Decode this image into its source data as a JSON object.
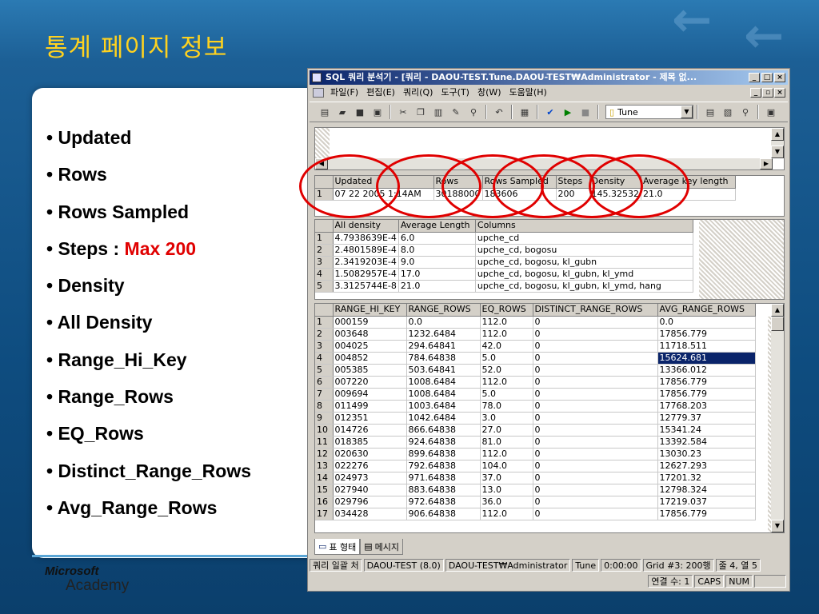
{
  "slide": {
    "title": "통계 페이지 정보",
    "bullets": [
      {
        "text": "Updated"
      },
      {
        "text": "Rows"
      },
      {
        "text": "Rows Sampled"
      },
      {
        "text": "Steps : ",
        "highlight": "Max 200"
      },
      {
        "text": "Density"
      },
      {
        "text": "All Density"
      },
      {
        "text": "Range_Hi_Key"
      },
      {
        "text": "Range_Rows"
      },
      {
        "text": "EQ_Rows"
      },
      {
        "text": "Distinct_Range_Rows"
      },
      {
        "text": "Avg_Range_Rows"
      }
    ],
    "logo_line1": "Microsoft",
    "logo_line2": "Academy",
    "colors": {
      "title": "#ffd21f",
      "highlight": "#e00000",
      "background": "#0e4c7f"
    }
  },
  "window": {
    "title": "SQL 쿼리 분석기 - [쿼리 - DAOU-TEST.Tune.DAOU-TEST₩Administrator - 제목 없...",
    "menu": [
      "파일(F)",
      "편집(E)",
      "쿼리(Q)",
      "도구(T)",
      "창(W)",
      "도움말(H)"
    ],
    "database": "Tune",
    "stats_header": {
      "columns": [
        "Updated",
        "Rows",
        "Rows Sampled",
        "Steps",
        "Density",
        "Average key length"
      ],
      "row": [
        "1",
        "07 22 2005  1:14AM",
        "30188000",
        "183606",
        "200",
        "145.32532",
        "21.0"
      ]
    },
    "density": {
      "columns": [
        "All density",
        "Average Length",
        "Columns"
      ],
      "rows": [
        [
          "1",
          "4.7938639E-4",
          "6.0",
          "upche_cd"
        ],
        [
          "2",
          "2.4801589E-4",
          "8.0",
          "upche_cd, bogosu"
        ],
        [
          "3",
          "2.3419203E-4",
          "9.0",
          "upche_cd, bogosu, kl_gubn"
        ],
        [
          "4",
          "1.5082957E-4",
          "17.0",
          "upche_cd, bogosu, kl_gubn, kl_ymd"
        ],
        [
          "5",
          "3.3125744E-8",
          "21.0",
          "upche_cd, bogosu, kl_gubn, kl_ymd, hang"
        ]
      ]
    },
    "histogram": {
      "columns": [
        "RANGE_HI_KEY",
        "RANGE_ROWS",
        "EQ_ROWS",
        "DISTINCT_RANGE_ROWS",
        "AVG_RANGE_ROWS"
      ],
      "rows": [
        [
          "1",
          "000159",
          "0.0",
          "112.0",
          "0",
          "0.0"
        ],
        [
          "2",
          "003648",
          "1232.6484",
          "112.0",
          "0",
          "17856.779"
        ],
        [
          "3",
          "004025",
          "294.64841",
          "42.0",
          "0",
          "11718.511"
        ],
        [
          "4",
          "004852",
          "784.64838",
          "5.0",
          "0",
          "15624.681"
        ],
        [
          "5",
          "005385",
          "503.64841",
          "52.0",
          "0",
          "13366.012"
        ],
        [
          "6",
          "007220",
          "1008.6484",
          "112.0",
          "0",
          "17856.779"
        ],
        [
          "7",
          "009694",
          "1008.6484",
          "5.0",
          "0",
          "17856.779"
        ],
        [
          "8",
          "011499",
          "1003.6484",
          "78.0",
          "0",
          "17768.203"
        ],
        [
          "9",
          "012351",
          "1042.6484",
          "3.0",
          "0",
          "12779.37"
        ],
        [
          "10",
          "014726",
          "866.64838",
          "27.0",
          "0",
          "15341.24"
        ],
        [
          "11",
          "018385",
          "924.64838",
          "81.0",
          "0",
          "13392.584"
        ],
        [
          "12",
          "020630",
          "899.64838",
          "112.0",
          "0",
          "13030.23"
        ],
        [
          "13",
          "022276",
          "792.64838",
          "104.0",
          "0",
          "12627.293"
        ],
        [
          "14",
          "024973",
          "971.64838",
          "37.0",
          "0",
          "17201.32"
        ],
        [
          "15",
          "027940",
          "883.64838",
          "13.0",
          "0",
          "12798.324"
        ],
        [
          "16",
          "029796",
          "972.64838",
          "36.0",
          "0",
          "17219.037"
        ],
        [
          "17",
          "034428",
          "906.64838",
          "112.0",
          "0",
          "17856.779"
        ]
      ],
      "selected": {
        "row": 3,
        "col": 4
      }
    },
    "tabs": [
      "표 형태",
      "메시지"
    ],
    "status1": [
      "쿼리 일괄 처",
      "DAOU-TEST (8.0)",
      "DAOU-TEST₩Administrator",
      "Tune",
      "0:00:00",
      "Grid #3: 200행",
      "줄 4, 열 5"
    ],
    "status2": [
      "연결 수: 1",
      "CAPS",
      "NUM",
      ""
    ]
  }
}
